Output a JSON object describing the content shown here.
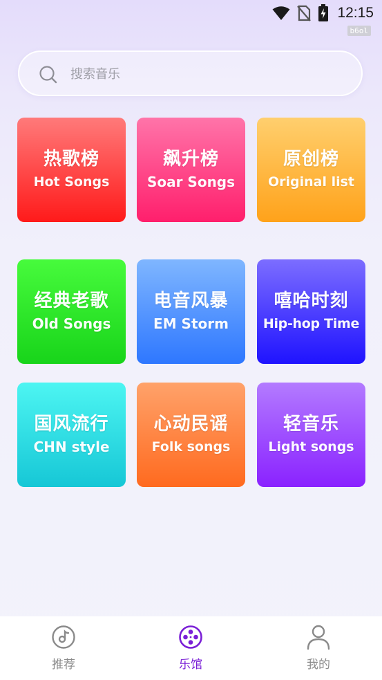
{
  "status_bar": {
    "time": "12:15",
    "badge": "b6ol",
    "icons": [
      "wifi-icon",
      "no-sim-icon",
      "battery-charging-icon"
    ]
  },
  "search": {
    "placeholder": "搜索音乐",
    "value": "",
    "icon": "search-icon"
  },
  "categories": [
    {
      "cn": "热歌榜",
      "en": "Hot Songs",
      "color": "#ff3b3b"
    },
    {
      "cn": "飙升榜",
      "en": "Soar Songs",
      "color": "#ff3f84"
    },
    {
      "cn": "原创榜",
      "en": "Original list",
      "color": "#ffb53a"
    },
    {
      "cn": "经典老歌",
      "en": "Old Songs",
      "color": "#2ee52a"
    },
    {
      "cn": "电音风暴",
      "en": "EM Storm",
      "color": "#4d92ff"
    },
    {
      "cn": "嘻哈时刻",
      "en": "Hip-hop Time",
      "color": "#3f33ff"
    },
    {
      "cn": "国风流行",
      "en": "CHN style",
      "color": "#2ddde6"
    },
    {
      "cn": "心动民谣",
      "en": "Folk songs",
      "color": "#ff8140"
    },
    {
      "cn": "轻音乐",
      "en": "Light songs",
      "color": "#9c4dff"
    }
  ],
  "bottom_nav": {
    "items": [
      {
        "label": "推荐",
        "icon": "music-disc-icon",
        "active": false
      },
      {
        "label": "乐馆",
        "icon": "film-reel-icon",
        "active": true
      },
      {
        "label": "我的",
        "icon": "user-icon",
        "active": false
      }
    ],
    "active_color": "#7a1fd6",
    "inactive_color": "#8a8a8a"
  }
}
